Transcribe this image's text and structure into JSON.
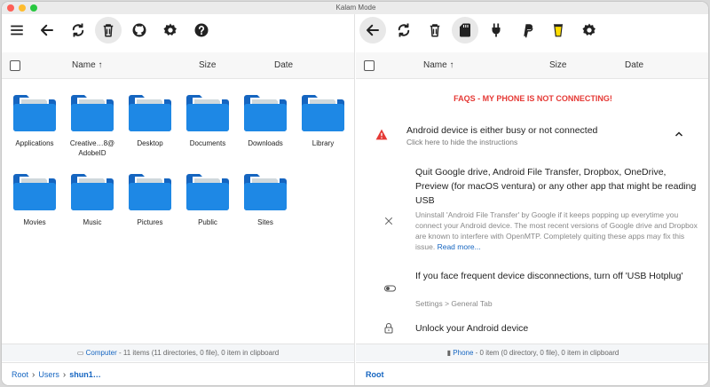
{
  "window": {
    "title": "Kalam Mode"
  },
  "left": {
    "columns": {
      "name": "Name",
      "sort_indicator": "↑",
      "size": "Size",
      "date": "Date"
    },
    "folders": [
      {
        "name": "Applications"
      },
      {
        "name": "Creative…8@ AdobeID"
      },
      {
        "name": "Desktop"
      },
      {
        "name": "Documents"
      },
      {
        "name": "Downloads"
      },
      {
        "name": "Library"
      },
      {
        "name": "Movies"
      },
      {
        "name": "Music"
      },
      {
        "name": "Pictures"
      },
      {
        "name": "Public"
      },
      {
        "name": "Sites"
      }
    ],
    "status": {
      "source": "Computer",
      "text": " - 11 items (11 directories, 0 file), 0 item in clipboard"
    },
    "breadcrumb": {
      "root": "Root",
      "users": "Users",
      "current": "shun1…"
    }
  },
  "right": {
    "columns": {
      "name": "Name",
      "sort_indicator": "↑",
      "size": "Size",
      "date": "Date"
    },
    "faq_title": "FAQS - MY PHONE IS NOT CONNECTING!",
    "issue": {
      "title": "Android device is either busy or not connected",
      "subtitle": "Click here to hide the instructions"
    },
    "tips": [
      {
        "title": "Quit Google drive, Android File Transfer, Dropbox, OneDrive, Preview (for macOS ventura) or any other app that might be reading USB",
        "body": "Uninstall 'Android File Transfer' by Google if it keeps popping up everytime you connect your Android device. The most recent versions of Google drive and Dropbox are known to interfere with OpenMTP. Completely quiting these apps may fix this issue.",
        "link": "Read more..."
      },
      {
        "title": "If you face frequent device disconnections, turn off 'USB Hotplug'",
        "body": "Settings > General Tab"
      },
      {
        "title": "Unlock your Android device"
      }
    ],
    "status": {
      "source": "Phone",
      "text": " - 0 item (0 directory, 0 file), 0 item in clipboard"
    },
    "breadcrumb": {
      "root": "Root"
    }
  },
  "colors": {
    "accent": "#1565c0",
    "folder": "#1e88e5",
    "warning": "#e53935"
  }
}
